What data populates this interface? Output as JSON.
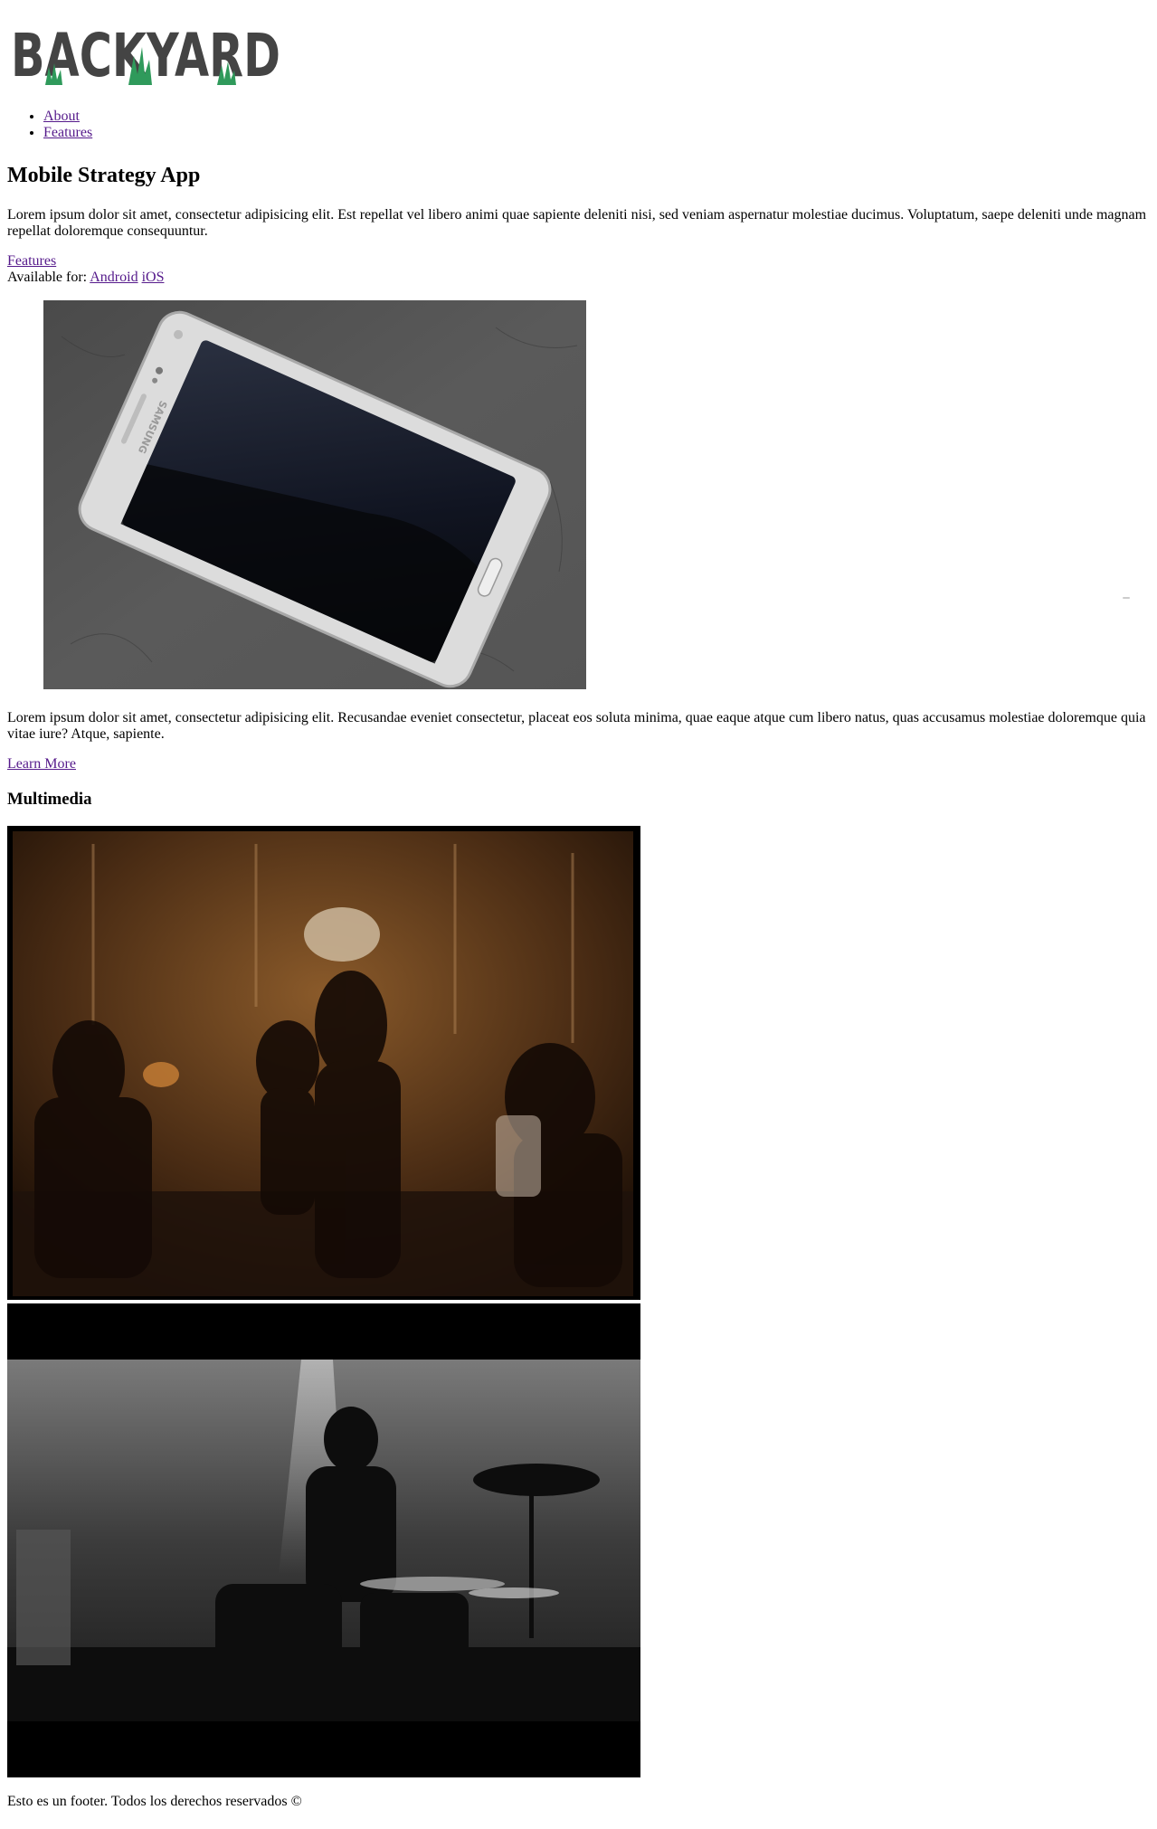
{
  "header": {
    "logo_text": "BACKYARD",
    "logo_color": "#444444",
    "logo_accent_color": "#2f9a5b"
  },
  "nav": {
    "items": [
      {
        "label": "About"
      },
      {
        "label": "Features"
      }
    ]
  },
  "hero": {
    "title": "Mobile Strategy App",
    "lead": "Lorem ipsum dolor sit amet, consectetur adipisicing elit. Est repellat vel libero animi quae sapiente deleniti nisi, sed veniam aspernatur molestiae ducimus. Voluptatum, saepe deleniti unde magnam repellat doloremque consequuntur.",
    "features_link": "Features",
    "available_label": "Available for:",
    "platforms": [
      "Android",
      "iOS"
    ]
  },
  "phone_image": {
    "brand_text": "SAMSUNG"
  },
  "content": {
    "paragraph": "Lorem ipsum dolor sit amet, consectetur adipisicing elit. Recusandae eveniet consectetur, placeat eos soluta minima, quae eaque atque cum libero natus, quas accusamus molestiae doloremque quia vitae iure? Atque, sapiente.",
    "learn_more": "Learn More"
  },
  "multimedia": {
    "heading": "Multimedia"
  },
  "footer": {
    "text": "Esto es un footer. Todos los derechos reservados ©"
  },
  "colors": {
    "link": "#551a8b",
    "text": "#000000",
    "background": "#ffffff"
  }
}
